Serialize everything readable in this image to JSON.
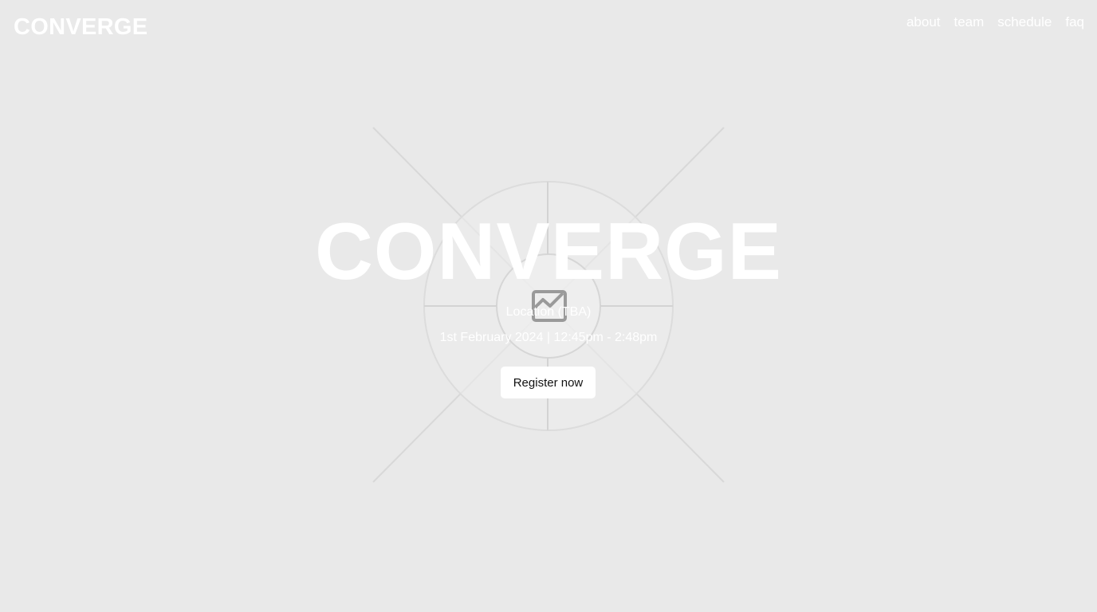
{
  "header": {
    "logo": "CONVERGE",
    "nav": [
      {
        "label": "about"
      },
      {
        "label": "team"
      },
      {
        "label": "schedule"
      },
      {
        "label": "faq"
      }
    ]
  },
  "hero": {
    "title": "CONVERGE",
    "location": "Location (TBA)",
    "datetime": "1st February 2024 | 12:45pm - 2:48pm",
    "register_label": "Register now",
    "background_icon": "image-placeholder-icon"
  },
  "colors": {
    "background": "#e9e9e9",
    "text": "#ffffff",
    "button_bg": "#ffffff",
    "button_text": "#111111",
    "placeholder_lines": "#d3d3d3"
  }
}
